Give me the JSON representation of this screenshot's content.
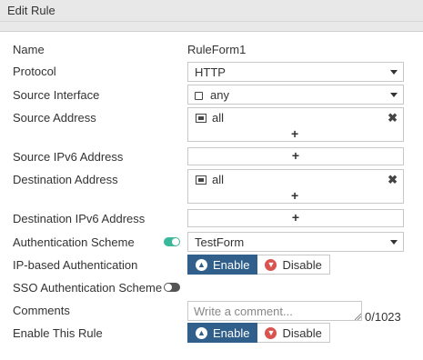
{
  "header": {
    "title": "Edit Rule"
  },
  "form": {
    "name": {
      "label": "Name",
      "value": "RuleForm1"
    },
    "protocol": {
      "label": "Protocol",
      "value": "HTTP"
    },
    "source_interface": {
      "label": "Source Interface",
      "value": "any",
      "icon": "interface-square-icon"
    },
    "source_address": {
      "label": "Source Address",
      "entry": "all",
      "remove": "✖",
      "add": "+"
    },
    "source_ipv6": {
      "label": "Source IPv6 Address",
      "add": "+"
    },
    "destination_address": {
      "label": "Destination Address",
      "entry": "all",
      "remove": "✖",
      "add": "+"
    },
    "destination_ipv6": {
      "label": "Destination IPv6 Address",
      "add": "+"
    },
    "auth_scheme": {
      "label": "Authentication Scheme",
      "value": "TestForm",
      "toggle": "on",
      "toggle_color": "#3bb89a"
    },
    "ip_based_auth": {
      "label": "IP-based Authentication",
      "enable": "Enable",
      "disable": "Disable",
      "selected": "Enable"
    },
    "sso_auth_scheme": {
      "label": "SSO Authentication Scheme",
      "toggle": "off"
    },
    "comments": {
      "label": "Comments",
      "placeholder": "Write a comment...",
      "counter": "0/1023"
    },
    "enable_rule": {
      "label": "Enable This Rule",
      "enable": "Enable",
      "disable": "Disable",
      "selected": "Enable"
    }
  },
  "colors": {
    "accent": "#2f5f8a",
    "danger": "#d9534f",
    "toggle_on": "#3bb89a"
  }
}
